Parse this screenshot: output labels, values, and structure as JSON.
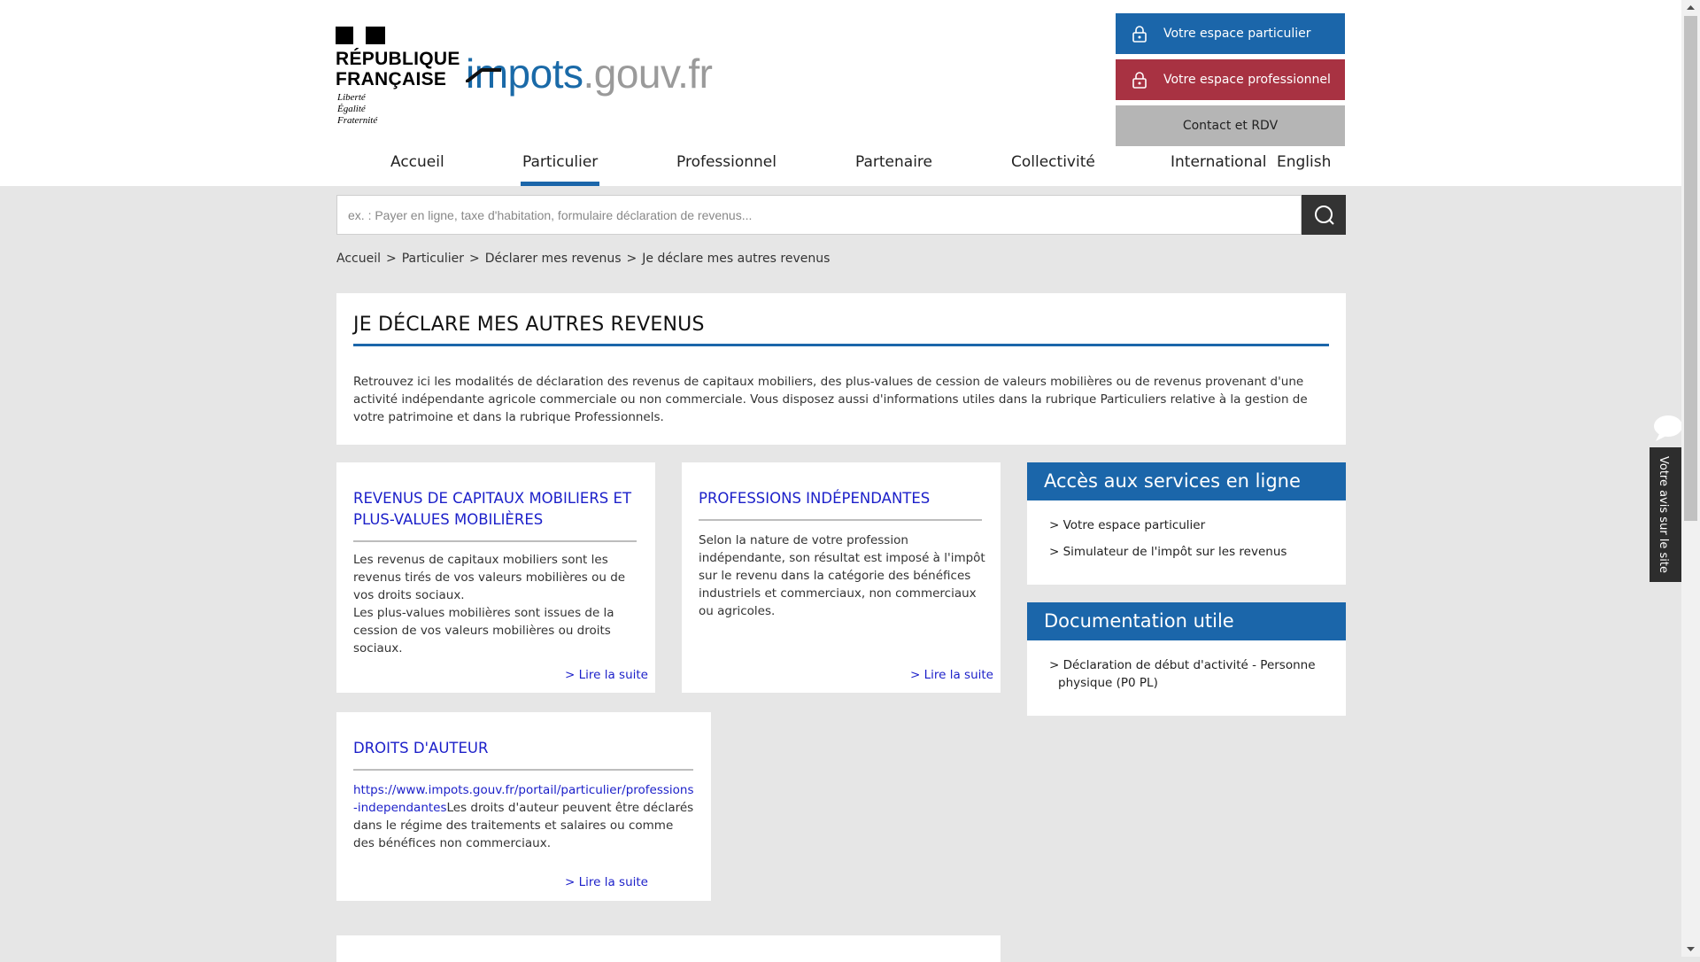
{
  "logo": {
    "rf_line1": "RÉPUBLIQUE",
    "rf_line2": "FRANÇAISE",
    "motto_1": "Liberté",
    "motto_2": "Égalité",
    "motto_3": "Fraternité",
    "site_prefix": "impots",
    "site_suffix": ".gouv.fr"
  },
  "top_buttons": {
    "particulier": "Votre espace particulier",
    "professionnel": "Votre espace professionnel",
    "contact": "Contact et RDV"
  },
  "nav": [
    "Accueil",
    "Particulier",
    "Professionnel",
    "Partenaire",
    "Collectivité",
    "International",
    "English"
  ],
  "search": {
    "placeholder": "ex. : Payer en ligne, taxe d'habitation, formulaire déclaration de revenus...",
    "value": ""
  },
  "breadcrumb": [
    "Accueil",
    "Particulier",
    "Déclarer mes revenus",
    "Je déclare mes autres revenus"
  ],
  "breadcrumb_sep": ">",
  "page": {
    "title": "JE DÉCLARE MES AUTRES REVENUS",
    "intro": "Retrouvez ici les modalités de déclaration des revenus de capitaux mobiliers, des plus-values de cession de valeurs mobilières ou de revenus provenant d'une activité indépendante agricole commerciale ou non commerciale. Vous disposez aussi d'informations utiles dans la rubrique Particuliers relative à la gestion de votre patrimoine et dans la rubrique Professionnels."
  },
  "cards": {
    "capitaux": {
      "title": "REVENUS DE CAPITAUX MOBILIERS ET PLUS-VALUES MOBILIÈRES",
      "text1": "Les revenus de capitaux mobiliers sont les revenus tirés de vos valeurs mobilières ou de vos droits sociaux.",
      "text2": "Les plus-values mobilières sont issues de la cession de vos valeurs mobilières ou droits sociaux.",
      "more": "> Lire la suite"
    },
    "independantes": {
      "title": "PROFESSIONS INDÉPENDANTES",
      "text": "Selon la nature de votre profession indépendante, son résultat est imposé à l'impôt sur le revenu dans la catégorie des bénéfices industriels et commerciaux, non commerciaux ou agricoles.",
      "more": "> Lire la suite"
    },
    "auteur": {
      "title": "DROITS D'AUTEUR",
      "link": "https://www.impots.gouv.fr/portail/particulier/professions-independantes",
      "text": "Les droits d'auteur peuvent être déclarés dans le régime des traitements et salaires ou comme des bénéfices non commerciaux.",
      "more": "> Lire la suite"
    }
  },
  "sidebar": {
    "services_title": "Accès aux services en ligne",
    "services": [
      "> Votre espace particulier",
      "> Simulateur de l'impôt sur les revenus"
    ],
    "docs_title": "Documentation utile",
    "docs": [
      "> Déclaration de début d'activité - Personne physique (P0 PL)"
    ]
  },
  "feedback_label": "Votre avis sur le site",
  "icons": {
    "lock": "lock-icon",
    "search": "search-icon",
    "feedback": "speech-bubble-icon",
    "scroll_up": "arrow-up-icon",
    "scroll_down": "arrow-down-icon"
  },
  "colors": {
    "primary_blue": "#1b66aa",
    "pro_red": "#a83242",
    "link_blue": "#1b1fc9",
    "contact_grey": "#b5b5b5",
    "background": "#e6e6e6"
  }
}
